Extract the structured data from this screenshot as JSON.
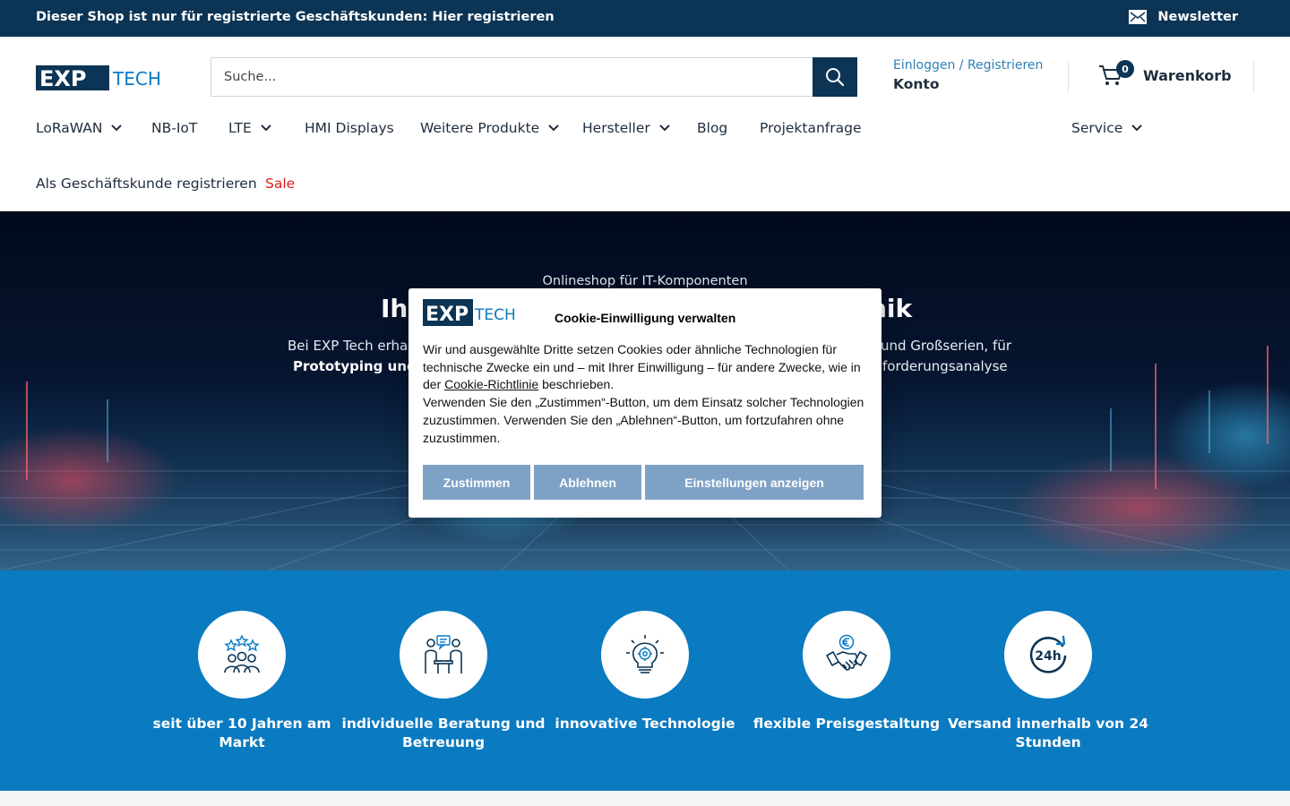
{
  "announcement": {
    "text": "Dieser Shop ist nur für registrierte Geschäftskunden: Hier registrieren",
    "newsletter_label": "Newsletter"
  },
  "header": {
    "logo_text_left": "EXP",
    "logo_text_right": "TECH",
    "search_placeholder": "Suche...",
    "login_label": "Einloggen / Registrieren",
    "account_label": "Konto",
    "cart_count": "0",
    "cart_label": "Warenkorb"
  },
  "nav": {
    "items": [
      {
        "label": "LoRaWAN",
        "dropdown": true
      },
      {
        "label": "NB-IoT",
        "dropdown": false
      },
      {
        "label": "LTE",
        "dropdown": true
      },
      {
        "label": "HMI Displays",
        "dropdown": false
      },
      {
        "label": "Weitere Produkte",
        "dropdown": true
      },
      {
        "label": "Hersteller",
        "dropdown": true
      },
      {
        "label": "Blog",
        "dropdown": false
      },
      {
        "label": "Projektanfrage",
        "dropdown": false
      },
      {
        "label": "Service",
        "dropdown": true
      },
      {
        "label": "Als Geschäftskunde registrieren",
        "dropdown": false
      },
      {
        "label": "Sale",
        "dropdown": false
      }
    ]
  },
  "hero": {
    "subtitle": "Onlineshop für IT-Komponenten",
    "title_left": "Ihr",
    "title_right": "nik",
    "line1_left": "Bei EXP Tech erhalte",
    "line1_right": "und Großserien, für",
    "line2_left": "Prototyping und",
    "line2_right": "forderungsanalyse"
  },
  "features": [
    {
      "label": "seit über 10 Jahren am Markt",
      "icon": "team-stars-icon"
    },
    {
      "label": "individuelle Beratung und Betreuung",
      "icon": "consulting-icon"
    },
    {
      "label": "innovative Technologie",
      "icon": "lightbulb-gear-icon"
    },
    {
      "label": "flexible Preisgestaltung",
      "icon": "handshake-euro-icon"
    },
    {
      "label": "Versand innerhalb von 24 Stunden",
      "icon": "24h-icon"
    }
  ],
  "cookie": {
    "title": "Cookie-Einwilligung verwalten",
    "text1": "Wir und ausgewählte Dritte setzen Cookies oder ähnliche Technologien für technische Zwecke ein und – mit Ihrer Einwilligung – für andere Zwecke, wie in der",
    "link": "Cookie-Richtlinie",
    "text2": "beschrieben.",
    "text3": "Verwenden Sie den „Zustimmen“-Button, um dem Einsatz solcher Technologien zuzustimmen. Verwenden Sie den „Ablehnen“-Button, um fortzufahren ohne zuzustimmen.",
    "accept": "Zustimmen",
    "reject": "Ablehnen",
    "settings": "Einstellungen anzeigen"
  },
  "colors": {
    "brand_dark": "#0c3454",
    "brand_blue": "#0a7ac1",
    "link_blue": "#2f7fb6",
    "sale_red": "#e21c1c",
    "modal_button": "#7ea2c6"
  }
}
